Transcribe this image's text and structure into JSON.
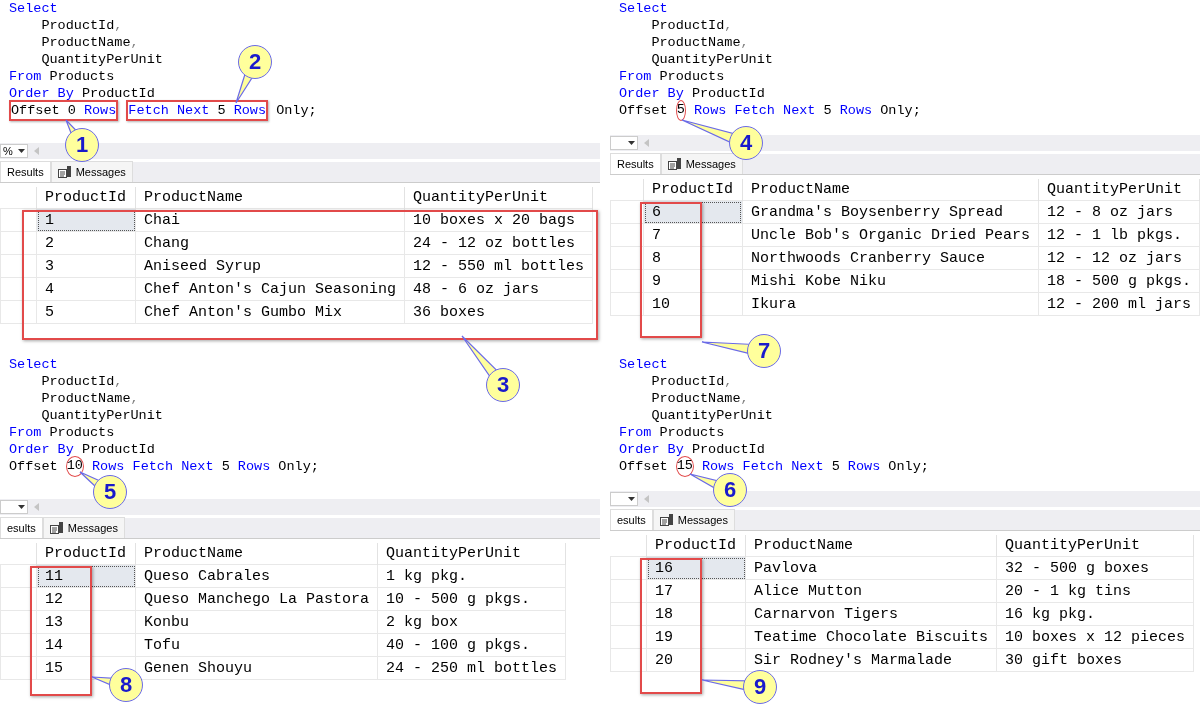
{
  "panels": [
    {
      "query": [
        [
          {
            "text": "Select",
            "kind": "keyword"
          }
        ],
        [
          {
            "text": "    ProductId",
            "kind": "ident"
          },
          {
            "text": ",",
            "kind": "punct"
          }
        ],
        [
          {
            "text": "    ProductName",
            "kind": "ident"
          },
          {
            "text": ",",
            "kind": "punct"
          }
        ],
        [
          {
            "text": "    QuantityPerUnit",
            "kind": "ident"
          }
        ],
        [
          {
            "text": "From",
            "kind": "keyword"
          },
          {
            "text": " Products",
            "kind": "ident"
          }
        ],
        [
          {
            "text": "Order By",
            "kind": "keyword"
          },
          {
            "text": " ProductId",
            "kind": "ident"
          }
        ],
        [
          {
            "kind": "group",
            "boxed": true,
            "tokens": [
              {
                "text": "Offset 0 ",
                "kind": "ident"
              },
              {
                "text": "Rows",
                "kind": "keyword"
              }
            ]
          },
          {
            "kind": "group",
            "boxed": true,
            "tokens": [
              {
                "text": "Fetch Next",
                "kind": "keyword"
              },
              {
                "text": " 5 ",
                "kind": "ident"
              },
              {
                "text": "Rows",
                "kind": "keyword"
              }
            ]
          },
          {
            "text": " Only;",
            "kind": "ident"
          }
        ]
      ],
      "zoom_value": "%",
      "results_tab": "Results",
      "messages_tab": "Messages",
      "columns": [
        "ProductId",
        "ProductName",
        "QuantityPerUnit"
      ],
      "rows_boxed": true,
      "id_column_boxed": false,
      "rows": [
        {
          "cells": [
            "1",
            "Chai",
            "10 boxes x 20 bags"
          ],
          "selected": true
        },
        {
          "cells": [
            "2",
            "Chang",
            "24 - 12 oz bottles"
          ],
          "selected": false
        },
        {
          "cells": [
            "3",
            "Aniseed Syrup",
            "12 - 550 ml bottles"
          ],
          "selected": false
        },
        {
          "cells": [
            "4",
            "Chef Anton's Cajun Seasoning",
            "48 - 6 oz jars"
          ],
          "selected": false
        },
        {
          "cells": [
            "5",
            "Chef Anton's Gumbo Mix",
            "36 boxes"
          ],
          "selected": false
        }
      ],
      "callouts": [
        "1",
        "2",
        "3"
      ]
    },
    {
      "query": [
        [
          {
            "text": "Select",
            "kind": "keyword"
          }
        ],
        [
          {
            "text": "    ProductId",
            "kind": "ident"
          },
          {
            "text": ",",
            "kind": "punct"
          }
        ],
        [
          {
            "text": "    ProductName",
            "kind": "ident"
          },
          {
            "text": ",",
            "kind": "punct"
          }
        ],
        [
          {
            "text": "    QuantityPerUnit",
            "kind": "ident"
          }
        ],
        [
          {
            "text": "From",
            "kind": "keyword"
          },
          {
            "text": " Products",
            "kind": "ident"
          }
        ],
        [
          {
            "text": "Order By",
            "kind": "keyword"
          },
          {
            "text": " ProductId",
            "kind": "ident"
          }
        ],
        [
          {
            "text": "Offset ",
            "kind": "ident"
          },
          {
            "kind": "group",
            "circled": true,
            "tokens": [
              {
                "text": "5",
                "kind": "ident"
              }
            ]
          },
          {
            "text": " Rows Fetch Next",
            "kind": "keyword"
          },
          {
            "text": " 5 ",
            "kind": "ident"
          },
          {
            "text": "Rows",
            "kind": "keyword"
          },
          {
            "text": " Only;",
            "kind": "ident"
          }
        ]
      ],
      "results_tab": "Results",
      "messages_tab": "Messages",
      "columns": [
        "ProductId",
        "ProductName",
        "QuantityPerUnit"
      ],
      "rows_boxed": false,
      "id_column_boxed": true,
      "rows": [
        {
          "cells": [
            "6",
            "Grandma's Boysenberry Spread",
            "12 - 8 oz jars"
          ],
          "selected": true
        },
        {
          "cells": [
            "7",
            "Uncle Bob's Organic Dried Pears",
            "12 - 1 lb pkgs."
          ],
          "selected": false
        },
        {
          "cells": [
            "8",
            "Northwoods Cranberry Sauce",
            "12 - 12 oz jars"
          ],
          "selected": false
        },
        {
          "cells": [
            "9",
            "Mishi Kobe Niku",
            "18 - 500 g pkgs."
          ],
          "selected": false
        },
        {
          "cells": [
            "10",
            "Ikura",
            "12 - 200 ml jars"
          ],
          "selected": false
        }
      ],
      "callouts": [
        "4",
        "7"
      ]
    },
    {
      "query": [
        [
          {
            "text": "Select",
            "kind": "keyword"
          }
        ],
        [
          {
            "text": "    ProductId",
            "kind": "ident"
          },
          {
            "text": ",",
            "kind": "punct"
          }
        ],
        [
          {
            "text": "    ProductName",
            "kind": "ident"
          },
          {
            "text": ",",
            "kind": "punct"
          }
        ],
        [
          {
            "text": "    QuantityPerUnit",
            "kind": "ident"
          }
        ],
        [
          {
            "text": "From",
            "kind": "keyword"
          },
          {
            "text": " Products",
            "kind": "ident"
          }
        ],
        [
          {
            "text": "Order By",
            "kind": "keyword"
          },
          {
            "text": " ProductId",
            "kind": "ident"
          }
        ],
        [
          {
            "text": "Offset ",
            "kind": "ident"
          },
          {
            "kind": "group",
            "circled": true,
            "tokens": [
              {
                "text": "10",
                "kind": "ident"
              }
            ]
          },
          {
            "text": " Rows Fetch Next",
            "kind": "keyword"
          },
          {
            "text": " 5 ",
            "kind": "ident"
          },
          {
            "text": "Rows",
            "kind": "keyword"
          },
          {
            "text": " Only;",
            "kind": "ident"
          }
        ]
      ],
      "results_tab": "esults",
      "messages_tab": "Messages",
      "columns": [
        "ProductId",
        "ProductName",
        "QuantityPerUnit"
      ],
      "rows_boxed": false,
      "id_column_boxed": true,
      "rows": [
        {
          "cells": [
            "11",
            "Queso Cabrales",
            "1 kg pkg."
          ],
          "selected": true
        },
        {
          "cells": [
            "12",
            "Queso Manchego La Pastora",
            "10 - 500 g pkgs."
          ],
          "selected": false
        },
        {
          "cells": [
            "13",
            "Konbu",
            "2 kg box"
          ],
          "selected": false
        },
        {
          "cells": [
            "14",
            "Tofu",
            "40 - 100 g pkgs."
          ],
          "selected": false
        },
        {
          "cells": [
            "15",
            "Genen Shouyu",
            "24 - 250 ml bottles"
          ],
          "selected": false
        }
      ],
      "callouts": [
        "5",
        "8"
      ]
    },
    {
      "query": [
        [
          {
            "text": "Select",
            "kind": "keyword"
          }
        ],
        [
          {
            "text": "    ProductId",
            "kind": "ident"
          },
          {
            "text": ",",
            "kind": "punct"
          }
        ],
        [
          {
            "text": "    ProductName",
            "kind": "ident"
          },
          {
            "text": ",",
            "kind": "punct"
          }
        ],
        [
          {
            "text": "    QuantityPerUnit",
            "kind": "ident"
          }
        ],
        [
          {
            "text": "From",
            "kind": "keyword"
          },
          {
            "text": " Products",
            "kind": "ident"
          }
        ],
        [
          {
            "text": "Order By",
            "kind": "keyword"
          },
          {
            "text": " ProductId",
            "kind": "ident"
          }
        ],
        [
          {
            "text": "Offset ",
            "kind": "ident"
          },
          {
            "kind": "group",
            "circled": true,
            "tokens": [
              {
                "text": "15",
                "kind": "ident"
              }
            ]
          },
          {
            "text": " Rows Fetch Next",
            "kind": "keyword"
          },
          {
            "text": " 5 ",
            "kind": "ident"
          },
          {
            "text": "Rows",
            "kind": "keyword"
          },
          {
            "text": " Only;",
            "kind": "ident"
          }
        ]
      ],
      "results_tab": "esults",
      "messages_tab": "Messages",
      "columns": [
        "ProductId",
        "ProductName",
        "QuantityPerUnit"
      ],
      "rows_boxed": false,
      "id_column_boxed": true,
      "rows": [
        {
          "cells": [
            "16",
            "Pavlova",
            "32 - 500 g boxes"
          ],
          "selected": true
        },
        {
          "cells": [
            "17",
            "Alice Mutton",
            "20 - 1 kg tins"
          ],
          "selected": false
        },
        {
          "cells": [
            "18",
            "Carnarvon Tigers",
            "16 kg pkg."
          ],
          "selected": false
        },
        {
          "cells": [
            "19",
            "Teatime Chocolate Biscuits",
            "10 boxes x 12 pieces"
          ],
          "selected": false
        },
        {
          "cells": [
            "20",
            "Sir Rodney's Marmalade",
            "30 gift boxes"
          ],
          "selected": false
        }
      ],
      "callouts": [
        "6",
        "9"
      ]
    }
  ]
}
